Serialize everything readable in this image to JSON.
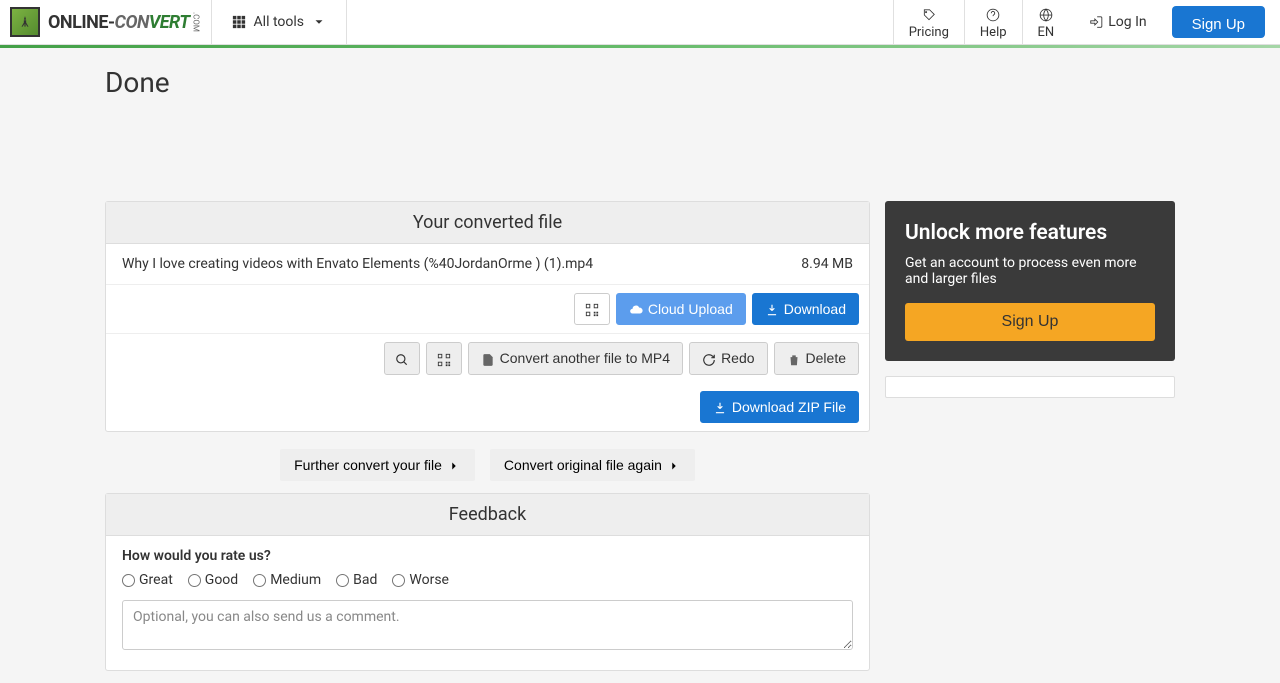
{
  "header": {
    "logo_text1": "ONLINE-",
    "logo_text2": "CON",
    "logo_text3": "VERT",
    "logo_sub": ".COM",
    "all_tools": "All tools",
    "pricing": "Pricing",
    "help": "Help",
    "lang": "EN",
    "login": "Log In",
    "signup": "Sign Up"
  },
  "page": {
    "title": "Done"
  },
  "file_panel": {
    "header": "Your converted file",
    "filename": "Why I love creating videos with Envato Elements (%40JordanOrme ) (1).mp4",
    "size": "8.94 MB",
    "cloud_upload": "Cloud Upload",
    "download": "Download",
    "convert_another": "Convert another file to MP4",
    "redo": "Redo",
    "delete": "Delete",
    "download_zip": "Download ZIP File",
    "further_convert": "Further convert your file",
    "convert_original": "Convert original file again"
  },
  "feedback": {
    "header": "Feedback",
    "question": "How would you rate us?",
    "options": [
      "Great",
      "Good",
      "Medium",
      "Bad",
      "Worse"
    ],
    "comment_placeholder": "Optional, you can also send us a comment."
  },
  "promo": {
    "title": "Unlock more features",
    "text": "Get an account to process even more and larger files",
    "button": "Sign Up"
  }
}
